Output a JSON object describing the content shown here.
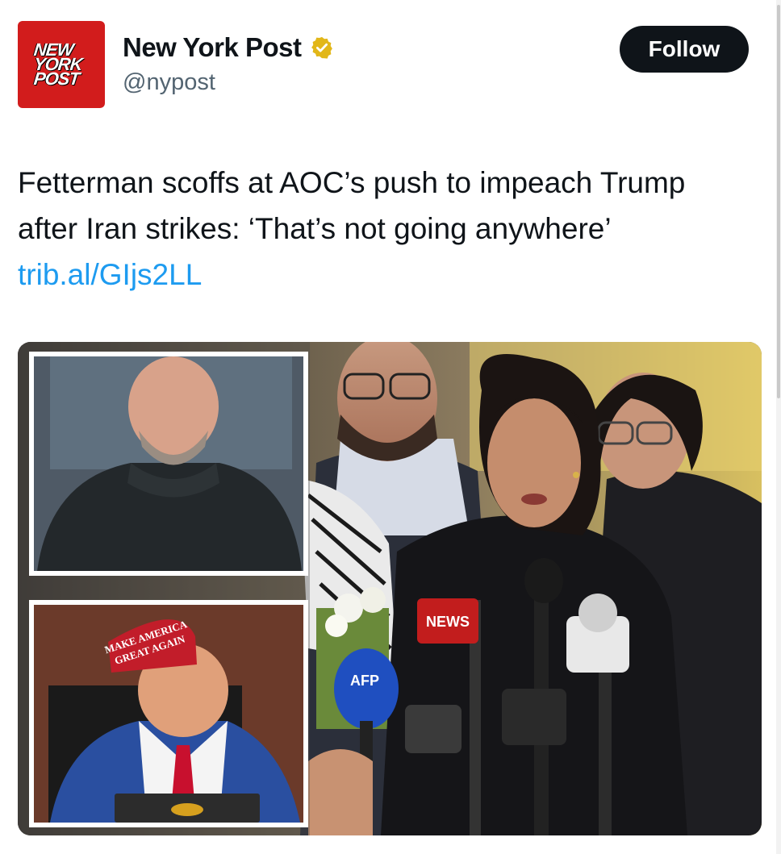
{
  "account": {
    "logo_lines": [
      "NEW",
      "YORK",
      "POST"
    ],
    "display_name": "New York Post",
    "handle": "@nypost",
    "verified_icon": "verified-gold-badge-icon"
  },
  "follow_button": {
    "label": "Follow"
  },
  "tweet": {
    "text": "Fetterman scoffs at AOC’s push to impeach Trump after Iran strikes: ‘That’s not going anywhere’",
    "link_text": "trib.al/GIjs2LL"
  },
  "media": {
    "hat_text_line1": "MAKE AMERICA",
    "hat_text_line2": "GREAT AGAIN",
    "mic_label_afp": "AFP",
    "mic_label_news": "NEWS"
  },
  "colors": {
    "brand_red": "#d21c1c",
    "link_blue": "#1d9bf0",
    "button_dark": "#0f1419",
    "handle_gray": "#536471",
    "verified_gold": "#e2b719"
  }
}
